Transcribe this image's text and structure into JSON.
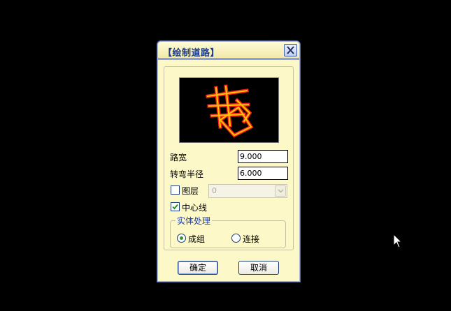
{
  "dialog": {
    "title": "【绘制道路】",
    "close_icon": "close-icon"
  },
  "fields": {
    "road_width_label": "路宽",
    "road_width_value": "9.000",
    "turn_radius_label": "转弯半径",
    "turn_radius_value": "6.000"
  },
  "layer": {
    "label": "图层",
    "checked": false,
    "selected_value": "0",
    "enabled": false
  },
  "centerline": {
    "label": "中心线",
    "checked": true
  },
  "solid_processing": {
    "legend": "实体处理",
    "options": [
      {
        "label": "成组",
        "selected": true
      },
      {
        "label": "连接",
        "selected": false
      }
    ]
  },
  "buttons": {
    "ok_label": "确定",
    "cancel_label": "取消"
  },
  "colors": {
    "dialog_bg": "#fdf8c8",
    "title_text": "#1a3a8a",
    "preview_road_outer": "#ff2020",
    "preview_road_inner": "#ffc800"
  }
}
